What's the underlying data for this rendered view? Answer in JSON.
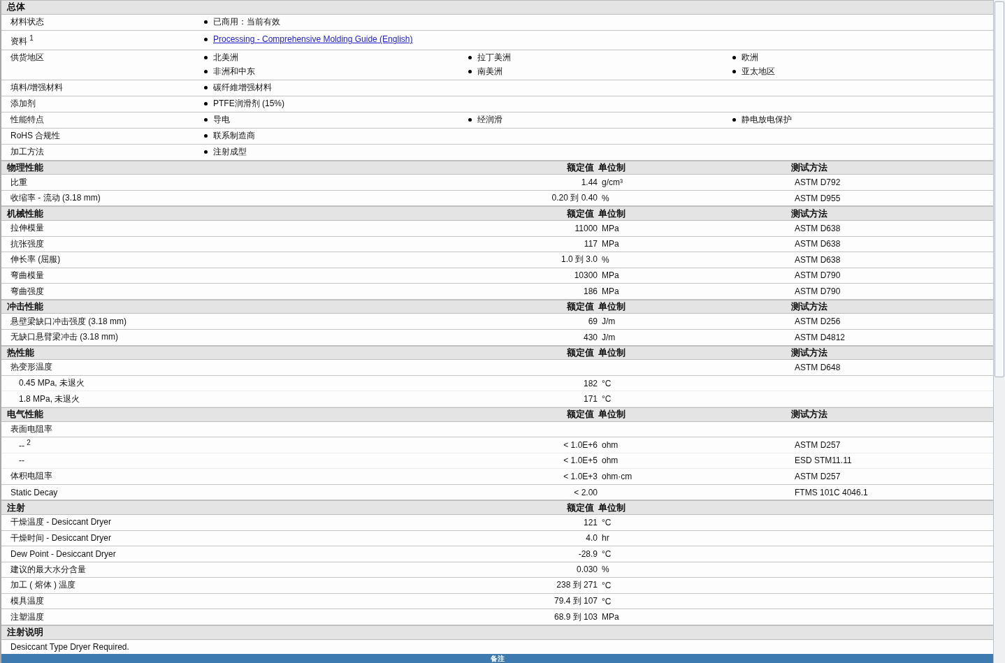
{
  "sections": [
    {
      "title": "总体",
      "kind": "general",
      "rows": [
        {
          "label": "材料状态",
          "items": [
            {
              "text": "已商用：当前有效",
              "kind": "text"
            }
          ]
        },
        {
          "label": "资料 $^{1}$",
          "items": [
            {
              "text": "Processing - Comprehensive Molding Guide (English)",
              "kind": "link"
            }
          ]
        },
        {
          "label": "供货地区",
          "items": [
            {
              "text": "北美洲",
              "kind": "text"
            },
            {
              "text": "拉丁美洲",
              "kind": "text"
            },
            {
              "text": "欧洲",
              "kind": "text"
            },
            {
              "text": "非洲和中东",
              "kind": "text"
            },
            {
              "text": "南美洲",
              "kind": "text"
            },
            {
              "text": "亚太地区",
              "kind": "text"
            }
          ]
        },
        {
          "label": "填料/增强材料",
          "items": [
            {
              "text": "碳纤維增强材料",
              "kind": "text"
            }
          ]
        },
        {
          "label": "添加剂",
          "items": [
            {
              "text": "PTFE润滑剂 (15%)",
              "kind": "text"
            }
          ]
        },
        {
          "label": "性能特点",
          "items": [
            {
              "text": "导电",
              "kind": "text"
            },
            {
              "text": "经润滑",
              "kind": "text"
            },
            {
              "text": "静电放电保护",
              "kind": "text"
            }
          ]
        },
        {
          "label": "RoHS 合规性",
          "items": [
            {
              "text": "联系制造商",
              "kind": "text"
            }
          ]
        },
        {
          "label": "加工方法",
          "items": [
            {
              "text": "注射成型",
              "kind": "text"
            }
          ]
        }
      ]
    },
    {
      "title": "物理性能",
      "kind": "table",
      "headers": {
        "value": "额定值",
        "unit": "单位制",
        "method": "测试方法"
      },
      "rows": [
        {
          "label": "比重",
          "value": "1.44",
          "unit": "g/cm³",
          "method": "ASTM D792"
        },
        {
          "label": "收缩率 - 流动 (3.18 mm)",
          "value": "0.20 到 0.40",
          "unit": "%",
          "method": "ASTM D955"
        }
      ]
    },
    {
      "title": "机械性能",
      "kind": "table",
      "headers": {
        "value": "额定值",
        "unit": "单位制",
        "method": "测试方法"
      },
      "rows": [
        {
          "label": "拉伸模量",
          "value": "11000",
          "unit": "MPa",
          "method": "ASTM D638"
        },
        {
          "label": "抗张强度",
          "value": "117",
          "unit": "MPa",
          "method": "ASTM D638"
        },
        {
          "label": "伸长率 (屈服)",
          "value": "1.0 到 3.0",
          "unit": "%",
          "method": "ASTM D638"
        },
        {
          "label": "弯曲模量",
          "value": "10300",
          "unit": "MPa",
          "method": "ASTM D790"
        },
        {
          "label": "弯曲强度",
          "value": "186",
          "unit": "MPa",
          "method": "ASTM D790"
        }
      ]
    },
    {
      "title": "冲击性能",
      "kind": "table",
      "headers": {
        "value": "额定值",
        "unit": "单位制",
        "method": "测试方法"
      },
      "rows": [
        {
          "label": "悬壁梁缺口冲击强度 (3.18 mm)",
          "value": "69",
          "unit": "J/m",
          "method": "ASTM D256"
        },
        {
          "label": "无缺口悬臂梁冲击 (3.18 mm)",
          "value": "430",
          "unit": "J/m",
          "method": "ASTM D4812"
        }
      ]
    },
    {
      "title": "热性能",
      "kind": "table",
      "headers": {
        "value": "额定值",
        "unit": "单位制",
        "method": "测试方法"
      },
      "rows": [
        {
          "label": "热变形温度",
          "method": "ASTM D648",
          "children": [
            {
              "label": "0.45 MPa, 未退火",
              "value": "182",
              "unit": "°C"
            },
            {
              "label": "1.8 MPa, 未退火",
              "value": "171",
              "unit": "°C"
            }
          ]
        }
      ]
    },
    {
      "title": "电气性能",
      "kind": "table",
      "headers": {
        "value": "额定值",
        "unit": "单位制",
        "method": "测试方法"
      },
      "rows": [
        {
          "label": "表面电阻率",
          "children": [
            {
              "label": "-- $^{2}$",
              "value": "< 1.0E+6",
              "unit": "ohm",
              "method": "ASTM D257"
            },
            {
              "label": "--",
              "value": "< 1.0E+5",
              "unit": "ohm",
              "method": "ESD STM11.11"
            }
          ]
        },
        {
          "label": "体积电阻率",
          "value": "< 1.0E+3",
          "unit": "ohm·cm",
          "method": "ASTM D257"
        },
        {
          "label": "Static Decay",
          "value": "< 2.00",
          "method": "FTMS 101C 4046.1"
        }
      ]
    },
    {
      "title": "注射",
      "kind": "table",
      "headers": {
        "value": "额定值",
        "unit": "单位制"
      },
      "rows": [
        {
          "label": "干燥温度 - Desiccant Dryer",
          "value": "121",
          "unit": "°C"
        },
        {
          "label": "干燥时间 - Desiccant Dryer",
          "value": "4.0",
          "unit": "hr"
        },
        {
          "label": "Dew Point - Desiccant Dryer",
          "value": "-28.9",
          "unit": "°C"
        },
        {
          "label": "建议的最大水分含量",
          "value": "0.030",
          "unit": "%"
        },
        {
          "label": "加工 ( 熔体 ) 温度",
          "value": "238 到 271",
          "unit": "°C"
        },
        {
          "label": "模具温度",
          "value": "79.4 到 107",
          "unit": "°C"
        },
        {
          "label": "注塑温度",
          "value": "68.9 到 103",
          "unit": "MPa"
        }
      ]
    },
    {
      "title": "注射说明",
      "kind": "note",
      "rows": [
        {
          "label": "Desiccant Type Dryer Required."
        }
      ]
    }
  ],
  "footer": {
    "title": "备注"
  }
}
